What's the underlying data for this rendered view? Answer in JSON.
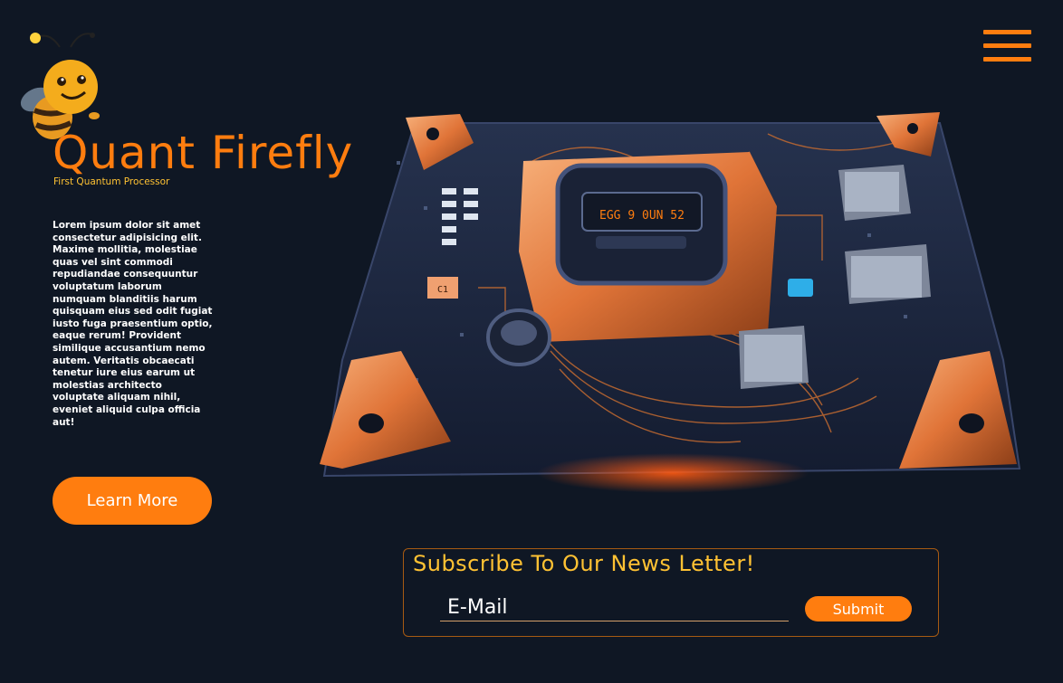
{
  "brand": {
    "title": "Quant Firefly",
    "subtitle": "First Quantum Processor",
    "mascot_icon": "bee-mascot-icon"
  },
  "nav": {
    "menu_icon": "hamburger-menu-icon"
  },
  "intro": {
    "description": "Lorem ipsum dolor sit amet consectetur adipisicing elit. Maxime mollitia, molestiae quas vel sint commodi repudiandae consequuntur voluptatum laborum numquam blanditiis harum quisquam eius sed odit fugiat iusto fuga praesentium optio, eaque rerum! Provident similique accusantium nemo autem. Veritatis obcaecati tenetur iure eius earum ut molestias architecto voluptate aliquam nihil, eveniet aliquid culpa officia aut!",
    "cta_label": "Learn More"
  },
  "hero": {
    "chip_label": "C1"
  },
  "newsletter": {
    "title": "Subscribe To Our News Letter!",
    "email_placeholder": "E-Mail",
    "email_value": "",
    "submit_label": "Submit"
  },
  "colors": {
    "background": "#0f1724",
    "accent": "#ff7d0f",
    "highlight": "#ffc233",
    "board": "#1f2a45"
  }
}
